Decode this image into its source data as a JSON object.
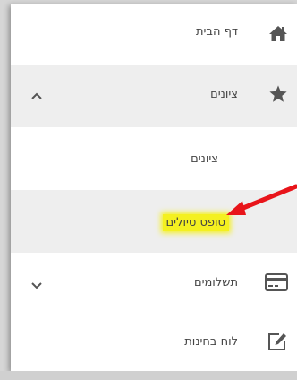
{
  "menu": {
    "home": {
      "label": "דף הבית",
      "icon": "home-icon"
    },
    "grades": {
      "label": "ציונים",
      "icon": "star-icon",
      "expanded": true
    },
    "grades_sub": {
      "label": "ציונים"
    },
    "forms": {
      "label": "טופס טיולים"
    },
    "payments": {
      "label": "תשלומים",
      "icon": "credit-card-icon",
      "expanded": false
    },
    "exams": {
      "label": "לוח בחינות",
      "icon": "edit-icon"
    }
  },
  "colors": {
    "highlight": "#f4f020",
    "arrow": "#e8141a",
    "row_active": "#eeeeee"
  }
}
